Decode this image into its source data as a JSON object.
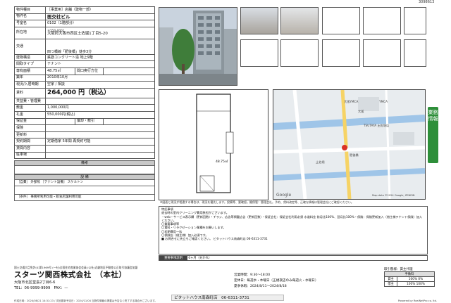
{
  "ref_no": "3098613",
  "spec": {
    "rows": [
      {
        "k": "物件種目",
        "v": "［事業用］店舗（建物一部）"
      },
      {
        "k": "物件名",
        "v": "医交社ビル"
      },
      {
        "k": "号室名",
        "v": "0102（1階部分）"
      },
      {
        "k": "所在地",
        "zip": "〒550-0001",
        "v": "大阪府大阪市西区土佐堀1丁目5-20"
      },
      {
        "k": "交通",
        "v": "四つ橋線「肥後橋」徒歩3分"
      },
      {
        "k": "建物構造",
        "v": "鉄筋コンクリート造 地上9階"
      },
      {
        "k": "間取タイプ",
        "v": "テナント"
      },
      {
        "k": "専有面積",
        "v": "48.75㎡",
        "k2": "間口奥行方位",
        "v2": ""
      },
      {
        "k": "築年",
        "v": "2010年10月"
      },
      {
        "k": "現況/入居時期",
        "v": "空家 / 相談"
      },
      {
        "k": "賃料",
        "v": "264,000 円（税込）"
      },
      {
        "k": "共益費・管理費",
        "v": ""
      },
      {
        "k": "敷金",
        "v": "1,000,000円"
      },
      {
        "k": "礼金",
        "v": "550,000円(税込)"
      },
      {
        "k": "保証金",
        "v": "",
        "k2": "償却・敷引",
        "v2": ""
      },
      {
        "k": "保険",
        "v": ""
      },
      {
        "k": "更新料",
        "v": ""
      },
      {
        "k": "契約期間",
        "v": "定期借家 5年間 再契約可能"
      },
      {
        "k": "貸間内容",
        "v": ""
      },
      {
        "k": "駐車場",
        "v": ""
      }
    ]
  },
  "bikou": {
    "label": "備考",
    "text": ""
  },
  "equip": {
    "label": "設 備",
    "line1": "［自費］ 外部照 ［テナント設備］ スケルトン",
    "line2": "［条件］ 事務所利用可能・飲食店舗利用可能"
  },
  "floor": {
    "area": "48.75㎡"
  },
  "map": {
    "labels": [
      "大阪YMCA",
      "YMCA",
      "大阪",
      "TSUTAYA 土佐堀店",
      "肥後橋",
      "土佐堀",
      "Map data ©2024 Google, ZENRIN"
    ],
    "google": "Google"
  },
  "side_tab": "業務情報",
  "note_strip": "※図面と現況が相違する場合は、現況を優先します。設備等、要確認。鍵保管：管理会社。予約、賃料改定等、正確な情報は管理会社にご確認ください。",
  "remarks": {
    "title": "特記事項",
    "lines": [
      "退去時の室内クリーニング費用負担がございます。",
      "・web・サービス表示欄（更新回数）・チラシ、広告等掲載広告（更新回数）・保証会社：保証会社利用必須 水道料金 前月比100%、翌月比100%・保険：保険更新加入（借主様テナント保険）加入ください。",
      "〇重要事項等",
      "〇賃料・リラクゼーション業種をお願いします。",
      "〇初期費用一括",
      "〇保険店（借主様）加入必須です。",
      "■ お問合せに先立ちご確認ください。 ビタットハウス南森町店  06-6311-3731"
    ]
  },
  "important": {
    "label": "重要事項説明",
    "text": "6ヶ月（分かれ）"
  },
  "footer": {
    "license": "国土交通大臣免許(4)第1969号  (一社)全国住宅産業協会会員  (公社)近畿地区不動産公正取引協議会加盟",
    "company": "スターツ関西株式会社　（本社）",
    "address": "大阪市北区堂島2丁目6-6",
    "tel": "TEL：06-9999-9999　FAX：—",
    "hours": "営業時間：9:30～18:00",
    "holiday": "定休日：毎週水・木曜日（正規夜店のみ毎週火・水曜日）",
    "closed": "夏季休暇：2024/8/11～2024/8/18",
    "shop": "ピタットハウス南森町店　06-6311-3731",
    "fee_title": "取引態様：賃主代理",
    "fee_head": "手数料",
    "fee_row1": [
      "貸主",
      "100% 0%"
    ],
    "fee_row2": [
      "借主",
      "100% 100%"
    ],
    "bottom_left": "作成日時：2024/08/21 14:31:23 / 次回更新予定日：2024/11/04 当物件情報の掲載は予告なく終了する場合がございます。",
    "bottom_right": "Powered by RealNetPro co. ltd."
  }
}
